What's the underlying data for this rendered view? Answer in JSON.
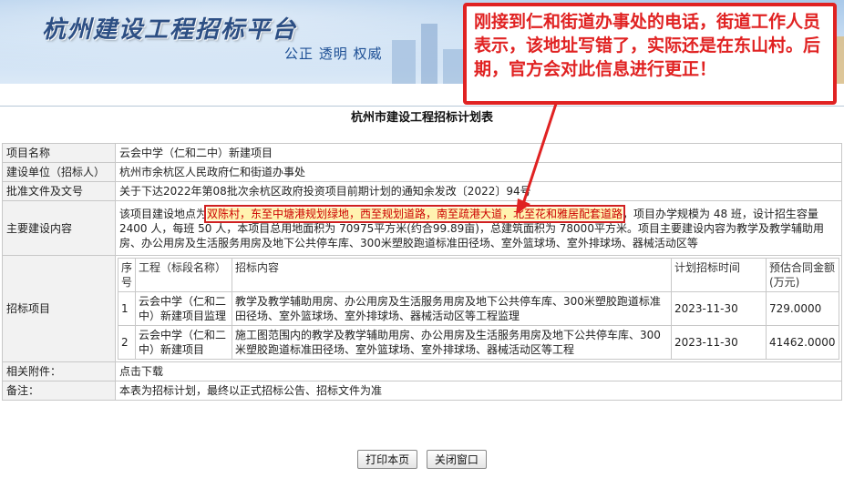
{
  "banner": {
    "title": "杭州建设工程招标平台",
    "slogan": "公正  透明  权威"
  },
  "callout": {
    "text": "刚接到仁和街道办事处的电话，街道工作人员表示，该地址写错了，实际还是在东山村。后期，官方会对此信息进行更正！",
    "color": "#e02222"
  },
  "form": {
    "title": "杭州市建设工程招标计划表",
    "project_name": {
      "label": "项目名称",
      "value": "云会中学（仁和二中）新建项目"
    },
    "builder": {
      "label": "建设单位（招标人）",
      "value": "杭州市余杭区人民政府仁和街道办事处"
    },
    "approval": {
      "label": "批准文件及文号",
      "value": "关于下达2022年第08批次余杭区政府投资项目前期计划的通知余发改〔2022〕94号"
    },
    "content": {
      "label": "主要建设内容",
      "prefix": "该项目建设地点为",
      "highlight": "双陈村，东至中塘港规划绿地，西至规划道路，南至疏港大道，北至花和雅居配套道路",
      "suffix": "，项目办学规模为 48 班，设计招生容量 2400 人，每班 50 人，本项目总用地面积为 70975平方米(约合99.89亩)，总建筑面积为 78000平方米。项目主要建设内容为教学及教学辅助用房、办公用房及生活服务用房及地下公共停车库、300米塑胶跑道标准田径场、室外篮球场、室外排球场、器械活动区等"
    },
    "tender": {
      "label": "招标项目",
      "headers": [
        "序号",
        "工程（标段名称）",
        "招标内容",
        "计划招标时间",
        "预估合同金额(万元)"
      ],
      "rows": [
        {
          "no": "1",
          "name": "云会中学（仁和二中）新建项目监理",
          "content": "教学及教学辅助用房、办公用房及生活服务用房及地下公共停车库、300米塑胶跑道标准田径场、室外篮球场、室外排球场、器械活动区等工程监理",
          "date": "2023-11-30",
          "amount": "729.0000"
        },
        {
          "no": "2",
          "name": "云会中学（仁和二中）新建项目",
          "content": "施工图范围内的教学及教学辅助用房、办公用房及生活服务用房及地下公共停车库、300米塑胶跑道标准田径场、室外篮球场、室外排球场、器械活动区等工程",
          "date": "2023-11-30",
          "amount": "41462.0000"
        }
      ]
    },
    "attachment": {
      "label": "相关附件：",
      "value": "点击下载"
    },
    "remark": {
      "label": "备注：",
      "value": "本表为招标计划，最终以正式招标公告、招标文件为准"
    }
  },
  "buttons": {
    "print": "打印本页",
    "close": "关闭窗口"
  }
}
